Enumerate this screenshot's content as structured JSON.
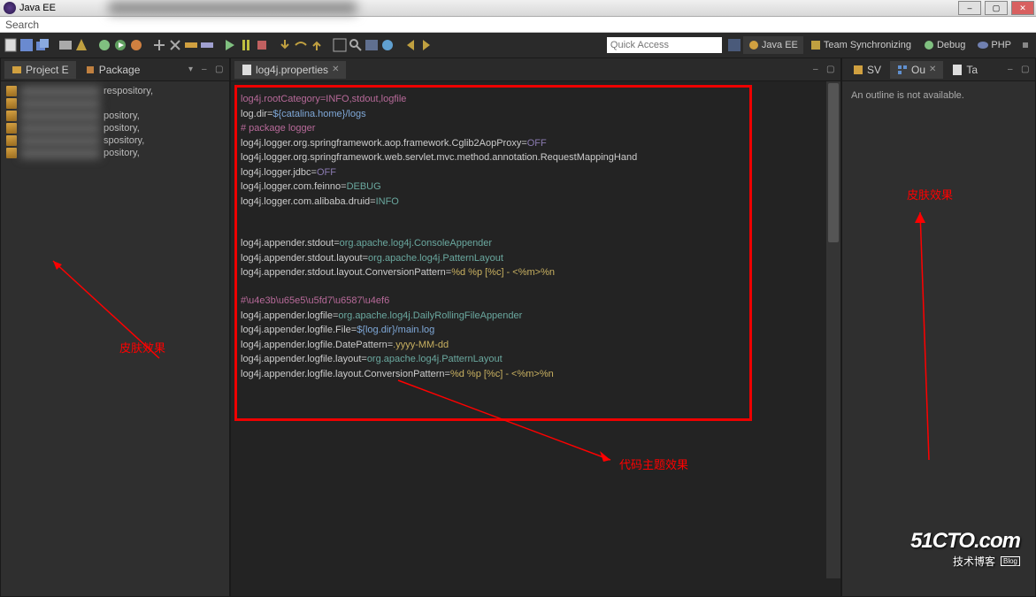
{
  "window": {
    "title": "Java EE",
    "menu_search": "Search"
  },
  "toolbar": {
    "quick_access_placeholder": "Quick Access"
  },
  "perspectives": [
    {
      "label": "Java EE",
      "active": true
    },
    {
      "label": "Team Synchronizing",
      "active": false
    },
    {
      "label": "Debug",
      "active": false
    },
    {
      "label": "PHP",
      "active": false
    }
  ],
  "left_panel": {
    "tabs": [
      {
        "label": "Project E",
        "active": true
      },
      {
        "label": "Package",
        "active": false
      }
    ],
    "tree_items": [
      {
        "suffix": "respository,"
      },
      {
        "suffix": ""
      },
      {
        "suffix": "pository,"
      },
      {
        "suffix": "pository,"
      },
      {
        "suffix": "spository,"
      },
      {
        "suffix": "pository,"
      }
    ]
  },
  "editor": {
    "tab_label": "log4j.properties",
    "lines": [
      {
        "t": "comment",
        "text": "log4j.rootCategory=INFO,stdout,logfile"
      },
      {
        "t": "kv",
        "k": "log.dir=",
        "v": "${catalina.home}/logs",
        "cls": "sp-val-blue"
      },
      {
        "t": "comment",
        "text": "# package logger"
      },
      {
        "t": "kv",
        "k": "log4j.logger.org.springframework.aop.framework.Cglib2AopProxy=",
        "v": "OFF",
        "cls": "sp-off"
      },
      {
        "t": "plain",
        "text": "log4j.logger.org.springframework.web.servlet.mvc.method.annotation.RequestMappingHand"
      },
      {
        "t": "kv",
        "k": "log4j.logger.jdbc=",
        "v": "OFF",
        "cls": "sp-off"
      },
      {
        "t": "kv",
        "k": "log4j.logger.com.feinno=",
        "v": "DEBUG",
        "cls": "sp-val-teal"
      },
      {
        "t": "kv",
        "k": "log4j.logger.com.alibaba.druid=",
        "v": "INFO",
        "cls": "sp-val-teal"
      },
      {
        "t": "blank",
        "text": ""
      },
      {
        "t": "blank",
        "text": ""
      },
      {
        "t": "kv",
        "k": "log4j.appender.stdout=",
        "v": "org.apache.log4j.ConsoleAppender",
        "cls": "sp-val-teal"
      },
      {
        "t": "kv",
        "k": "log4j.appender.stdout.layout=",
        "v": "org.apache.log4j.PatternLayout",
        "cls": "sp-val-teal"
      },
      {
        "t": "kv",
        "k": "log4j.appender.stdout.layout.ConversionPattern=",
        "v": "%d %p [%c] - <%m>%n",
        "cls": "sp-val-yellow"
      },
      {
        "t": "blank",
        "text": ""
      },
      {
        "t": "comment",
        "text": "#\\u4e3b\\u65e5\\u5fd7\\u6587\\u4ef6"
      },
      {
        "t": "kv",
        "k": "log4j.appender.logfile=",
        "v": "org.apache.log4j.DailyRollingFileAppender",
        "cls": "sp-val-teal"
      },
      {
        "t": "kv",
        "k": "log4j.appender.logfile.File=",
        "v": "${log.dir}/main.log",
        "cls": "sp-val-blue"
      },
      {
        "t": "kv",
        "k": "log4j.appender.logfile.DatePattern=",
        "v": ".yyyy-MM-dd",
        "cls": "sp-val-yellow"
      },
      {
        "t": "kv",
        "k": "log4j.appender.logfile.layout=",
        "v": "org.apache.log4j.PatternLayout",
        "cls": "sp-val-teal"
      },
      {
        "t": "kv",
        "k": "log4j.appender.logfile.layout.ConversionPattern=",
        "v": "%d %p [%c] - <%m>%n",
        "cls": "sp-val-yellow"
      }
    ]
  },
  "right_panel": {
    "tabs": [
      {
        "label": "SV",
        "active": false
      },
      {
        "label": "Ou",
        "active": true
      },
      {
        "label": "Ta",
        "active": false
      }
    ],
    "outline_msg": "An outline is not available."
  },
  "annotations": {
    "left": "皮肤效果",
    "center": "代码主题效果",
    "right": "皮肤效果"
  },
  "watermark": {
    "big": "51CTO.com",
    "small": "技术博客",
    "tag": "Blog"
  }
}
